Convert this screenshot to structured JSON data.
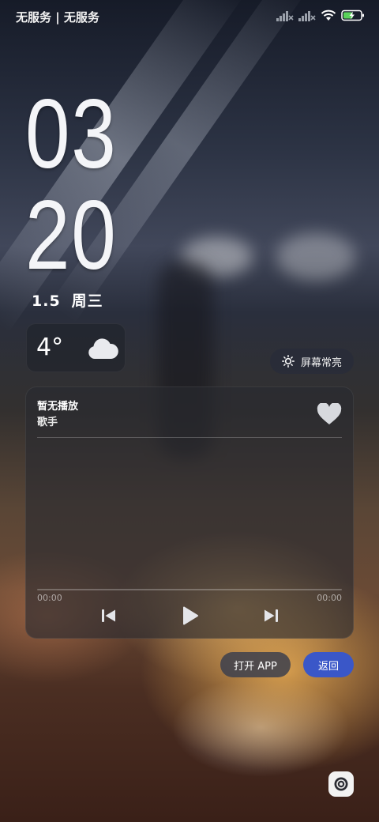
{
  "status_bar": {
    "carrier": "无服务 | 无服务",
    "battery_level": 0.55,
    "icons": [
      "signal-1-off-icon",
      "signal-2-off-icon",
      "wifi-icon",
      "battery-charging-icon"
    ]
  },
  "clock": {
    "hour": "03",
    "minute": "20"
  },
  "date": {
    "date": "1.5",
    "weekday": "周三"
  },
  "weather": {
    "temperature": "4°",
    "condition_icon": "cloud-icon"
  },
  "always_on": {
    "label": "屏幕常亮",
    "icon": "sun-icon"
  },
  "player": {
    "title": "暂无播放",
    "artist": "歌手",
    "current_time": "00:00",
    "total_time": "00:00",
    "progress": 0,
    "icons": [
      "heart-icon",
      "previous-icon",
      "play-icon",
      "next-icon"
    ]
  },
  "actions": {
    "open_app": "打开 APP",
    "back": "返回"
  },
  "camera": {
    "icon": "camera-icon"
  },
  "colors": {
    "accent": "#3a57c8",
    "text": "#ffffff"
  }
}
